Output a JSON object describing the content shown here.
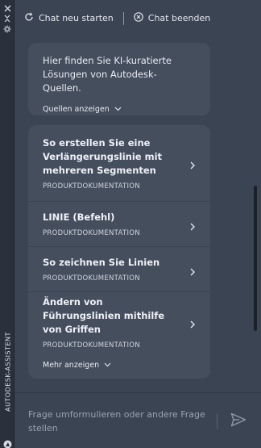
{
  "side_panel": {
    "title": "AUTODESK-ASSISTENT",
    "icons": [
      "close-icon",
      "collapse-icon",
      "settings-icon",
      "autodesk-logo-icon"
    ]
  },
  "toolbar": {
    "new_chat": {
      "label": "Chat neu starten",
      "icon": "restart-icon"
    },
    "end_chat": {
      "label": "Chat beenden",
      "icon": "close-circle-icon"
    }
  },
  "intro": {
    "text": "Hier finden Sie KI-kuratierte Lösungen von Autodesk-Quellen.",
    "show_sources_label": "Quellen anzeigen"
  },
  "results": {
    "items": [
      {
        "title": "So erstellen Sie eine Verlängerungslinie mit mehreren Segmenten",
        "source": "PRODUKTDOKUMENTATION"
      },
      {
        "title": "LINIE (Befehl)",
        "source": "PRODUKTDOKUMENTATION"
      },
      {
        "title": "So zeichnen Sie Linien",
        "source": "PRODUKTDOKUMENTATION"
      },
      {
        "title": "Ändern von Führungslinien mithilfe von Griffen",
        "source": "PRODUKTDOKUMENTATION"
      }
    ],
    "show_more_label": "Mehr anzeigen"
  },
  "input": {
    "placeholder": "Frage umformulieren oder andere Frage stellen"
  },
  "colors": {
    "panel_bg": "#3b4453",
    "card_bg": "#454e5d",
    "strip_bg": "#2b313c",
    "text": "#e8ecf2",
    "placeholder": "#9aa3b0",
    "send_icon": "#8f99a8"
  }
}
